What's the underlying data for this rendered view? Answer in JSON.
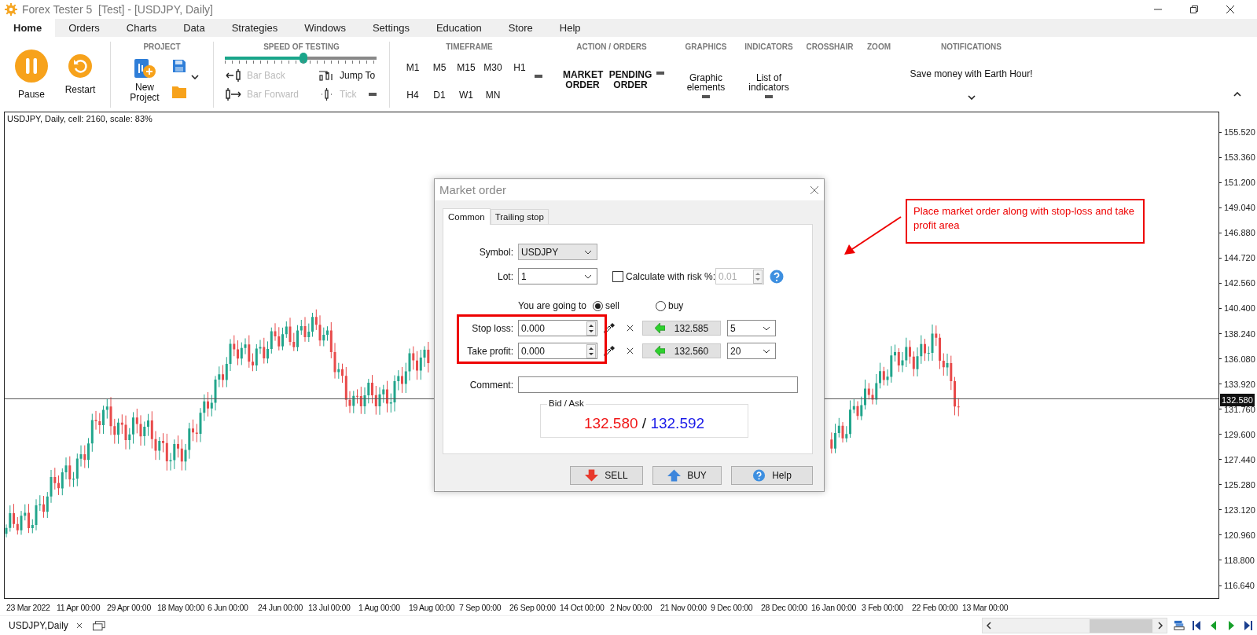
{
  "window": {
    "title": "Forex Tester 5  [Test] - [USDJPY, Daily]"
  },
  "menu_tabs": [
    {
      "label": "Home",
      "selected": true
    },
    {
      "label": "Orders",
      "selected": false
    },
    {
      "label": "Charts",
      "selected": false
    },
    {
      "label": "Data",
      "selected": false
    },
    {
      "label": "Strategies",
      "selected": false
    },
    {
      "label": "Windows",
      "selected": false
    },
    {
      "label": "Settings",
      "selected": false
    },
    {
      "label": "Education",
      "selected": false
    },
    {
      "label": "Store",
      "selected": false
    },
    {
      "label": "Help",
      "selected": false
    }
  ],
  "ribbon": {
    "playback": [
      {
        "label": "Pause",
        "kind": "pause"
      },
      {
        "label": "Restart",
        "kind": "restart"
      }
    ],
    "project": {
      "header": "PROJECT",
      "new_project": "New Project"
    },
    "speed": {
      "header": "SPEED OF TESTING",
      "level": 0.52,
      "steps": [
        {
          "label": "Bar Back",
          "kind": "bar-back",
          "disabled": true
        },
        {
          "label": "Jump To",
          "kind": "jump-to",
          "disabled": false
        },
        {
          "label": "Bar Forward",
          "kind": "bar-forward",
          "disabled": true
        },
        {
          "label": "Tick",
          "kind": "tick",
          "disabled": true
        }
      ]
    },
    "timeframe": {
      "header": "TIMEFRAME",
      "rows": [
        [
          "M1",
          "M5",
          "M15",
          "M30",
          "H1"
        ],
        [
          "H4",
          "D1",
          "W1",
          "MN"
        ]
      ]
    },
    "action_orders": {
      "header": "ACTION / ORDERS",
      "buttons": [
        "MARKET ORDER",
        "PENDING ORDER"
      ]
    },
    "graphics": {
      "header": "GRAPHICS",
      "button": "Graphic elements"
    },
    "indicators": {
      "header": "INDICATORS",
      "button": "List of indicators"
    },
    "crosshair": {
      "header": "CROSSHAIR"
    },
    "zoom": {
      "header": "ZOOM"
    },
    "notifications": {
      "header": "NOTIFICATIONS",
      "message": "Save money with Earth Hour!"
    }
  },
  "chart": {
    "info": "USDJPY, Daily, cell: 2160, scale: 83%",
    "current_price": "132.580",
    "price_labels": [
      "155.520",
      "153.360",
      "151.200",
      "149.040",
      "146.880",
      "144.720",
      "142.560",
      "140.400",
      "138.240",
      "136.080",
      "133.920",
      "131.760",
      "129.600",
      "127.440",
      "125.280",
      "123.120",
      "120.960",
      "118.800",
      "116.640"
    ],
    "date_labels": [
      "23 Mar 2022",
      "11 Apr 00:00",
      "29 Apr 00:00",
      "18 May 00:00",
      "6 Jun 00:00",
      "24 Jun 00:00",
      "13 Jul 00:00",
      "1 Aug 00:00",
      "19 Aug 00:00",
      "7 Sep 00:00",
      "26 Sep 00:00",
      "14 Oct 00:00",
      "2 Nov 00:00",
      "21 Nov 00:00",
      "9 Dec 00:00",
      "28 Dec 00:00",
      "16 Jan 00:00",
      "3 Feb 00:00",
      "22 Feb 00:00",
      "13 Mar 00:00"
    ]
  },
  "annotation": "Place market order along with stop-loss and take profit area",
  "dialog": {
    "title": "Market order",
    "tabs": [
      {
        "label": "Common",
        "selected": true
      },
      {
        "label": "Trailing stop",
        "selected": false
      }
    ],
    "symbol": {
      "label": "Symbol:",
      "value": "USDJPY"
    },
    "lot": {
      "label": "Lot:",
      "value": "1"
    },
    "risk": {
      "label": "Calculate with risk %:",
      "checked": false,
      "value": "0.01",
      "disabled": true
    },
    "direction": {
      "label": "You are going to",
      "options": [
        {
          "label": "sell",
          "selected": true
        },
        {
          "label": "buy",
          "selected": false
        }
      ]
    },
    "levels": [
      {
        "label": "Stop loss:",
        "value": "0.000",
        "price": "132.585",
        "points": "5"
      },
      {
        "label": "Take profit:",
        "value": "0.000",
        "price": "132.560",
        "points": "20"
      }
    ],
    "comment": {
      "label": "Comment:"
    },
    "bid_ask": {
      "label": "Bid / Ask",
      "bid": "132.580",
      "separator": "/",
      "ask": "132.592"
    },
    "buttons": [
      {
        "label": "SELL",
        "kind": "sell"
      },
      {
        "label": "BUY",
        "kind": "buy"
      },
      {
        "label": "Help",
        "kind": "help"
      }
    ]
  },
  "bottom_tab": {
    "label": "USDJPY,Daily"
  }
}
